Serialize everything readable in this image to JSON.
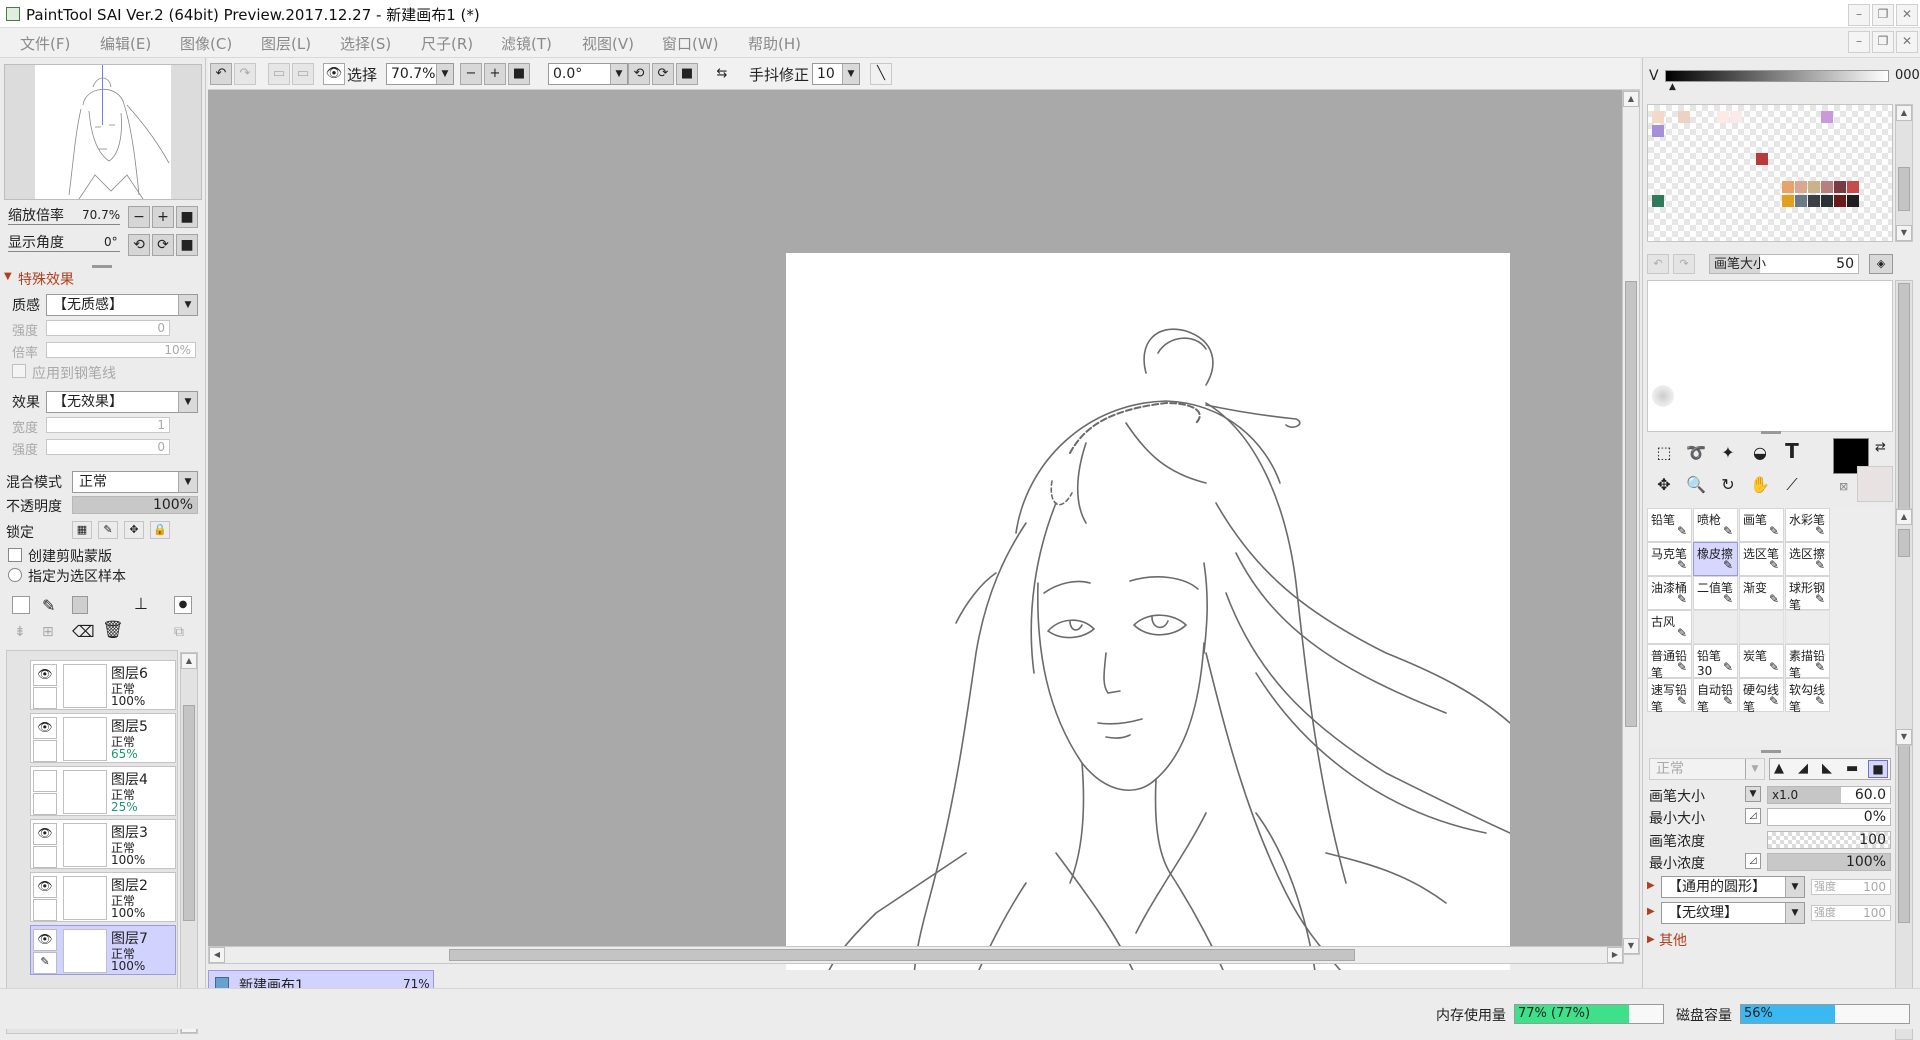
{
  "titlebar": {
    "title": "PaintTool SAI Ver.2 (64bit) Preview.2017.12.27 - 新建画布1 (*)"
  },
  "menu": [
    "文件(F)",
    "编辑(E)",
    "图像(C)",
    "图层(L)",
    "选择(S)",
    "尺子(R)",
    "滤镜(T)",
    "视图(V)",
    "窗口(W)",
    "帮助(H)"
  ],
  "toolbar": {
    "select_label": "选择",
    "zoom": "70.7%",
    "angle": "0.0°",
    "stabilizer_label": "手抖修正",
    "stabilizer": "10"
  },
  "navigator": {
    "zoom_label": "缩放倍率",
    "zoom_value": "70.7%",
    "angle_label": "显示角度",
    "angle_value": "0°"
  },
  "effects": {
    "header": "特殊效果",
    "texture_label": "质感",
    "texture_value": "【无质感】",
    "strength_label": "强度",
    "strength_value": "0",
    "scale_label": "倍率",
    "scale_value": "10%",
    "apply_pen_label": "应用到钢笔线",
    "effect_label": "效果",
    "effect_value": "【无效果】",
    "width_label": "宽度",
    "width_value": "1",
    "strength2_label": "强度",
    "strength2_value": "0"
  },
  "layer_props": {
    "blend_label": "混合模式",
    "blend_value": "正常",
    "opacity_label": "不透明度",
    "opacity_value": "100%",
    "opacity_fraction": 1.0,
    "lock_label": "锁定",
    "clip_label": "创建剪贴蒙版",
    "sample_label": "指定为选区样本"
  },
  "layers": [
    {
      "name": "图层6",
      "mode": "正常",
      "opacity": "100%",
      "visible": true,
      "selected": false
    },
    {
      "name": "图层5",
      "mode": "正常",
      "opacity": "65%",
      "visible": true,
      "selected": false
    },
    {
      "name": "图层4",
      "mode": "正常",
      "opacity": "25%",
      "visible": false,
      "selected": false
    },
    {
      "name": "图层3",
      "mode": "正常",
      "opacity": "100%",
      "visible": true,
      "selected": false
    },
    {
      "name": "图层2",
      "mode": "正常",
      "opacity": "100%",
      "visible": true,
      "selected": false
    },
    {
      "name": "图层7",
      "mode": "正常",
      "opacity": "100%",
      "visible": true,
      "selected": true
    }
  ],
  "doc_tab": {
    "name": "新建画布1",
    "zoom": "71%"
  },
  "color": {
    "v_label": "V",
    "v_value": "000",
    "current": "#000000",
    "bg": "#e8e2e2"
  },
  "swatches": [
    {
      "col": 0,
      "row": 0,
      "color": "#f2d9c8"
    },
    {
      "col": 2,
      "row": 0,
      "color": "#ecd2c0"
    },
    {
      "col": 5,
      "row": 0,
      "color": "#fbeae6"
    },
    {
      "col": 6,
      "row": 0,
      "color": "#fbeaea"
    },
    {
      "col": 13,
      "row": 0,
      "color": "#c79adc"
    },
    {
      "col": 0,
      "row": 1,
      "color": "#a690d8"
    },
    {
      "col": 8,
      "row": 3,
      "color": "#b83a3a"
    },
    {
      "col": 10,
      "row": 5,
      "color": "#e6a46a"
    },
    {
      "col": 11,
      "row": 5,
      "color": "#d9a890"
    },
    {
      "col": 12,
      "row": 5,
      "color": "#c9b48a"
    },
    {
      "col": 13,
      "row": 5,
      "color": "#b78080"
    },
    {
      "col": 14,
      "row": 5,
      "color": "#7a3a44"
    },
    {
      "col": 15,
      "row": 5,
      "color": "#c84a4a"
    },
    {
      "col": 0,
      "row": 6,
      "color": "#2e7a5a"
    },
    {
      "col": 10,
      "row": 6,
      "color": "#e0a020"
    },
    {
      "col": 11,
      "row": 6,
      "color": "#6c7a86"
    },
    {
      "col": 12,
      "row": 6,
      "color": "#3a4046"
    },
    {
      "col": 13,
      "row": 6,
      "color": "#2a3236"
    },
    {
      "col": 14,
      "row": 6,
      "color": "#6a1a1a"
    },
    {
      "col": 15,
      "row": 6,
      "color": "#1e1e1e"
    }
  ],
  "brush_preview": {
    "size_label": "画笔大小",
    "size_value": "50"
  },
  "brushes": [
    [
      "铅笔",
      "喷枪",
      "画笔",
      "水彩笔"
    ],
    [
      "马克笔",
      "橡皮擦",
      "选区笔",
      "选区擦"
    ],
    [
      "油漆桶",
      "二值笔",
      "渐变",
      "球形钢笔"
    ],
    [
      "古风",
      "",
      "",
      ""
    ],
    [
      "普通铅笔",
      "铅笔30",
      "炭笔",
      "素描铅笔"
    ],
    [
      "速写铅笔",
      "自动铅笔",
      "硬勾线笔",
      "软勾线笔"
    ]
  ],
  "brush_selected": "橡皮擦",
  "brush_settings": {
    "mode_value": "正常",
    "size_label": "画笔大小",
    "size_mult": "x1.0",
    "size_value": "60.0",
    "min_size_label": "最小大小",
    "min_size_value": "0%",
    "density_label": "画笔浓度",
    "density_value": "100",
    "min_density_label": "最小浓度",
    "min_density_value": "100%",
    "min_density_fraction": 1.0,
    "shape_value": "【通用的圆形】",
    "shape_strength_label": "强度",
    "shape_strength": "100",
    "texture_value": "【无纹理】",
    "texture_strength_label": "强度",
    "texture_strength": "100",
    "other_label": "其他"
  },
  "status": {
    "mem_label": "内存使用量",
    "mem_value": "77% (77%)",
    "mem_fraction": 0.77,
    "disk_label": "磁盘容量",
    "disk_value": "56%",
    "disk_fraction": 0.56,
    "mem_color": "#3ee08a",
    "disk_color": "#3ab8f0"
  }
}
